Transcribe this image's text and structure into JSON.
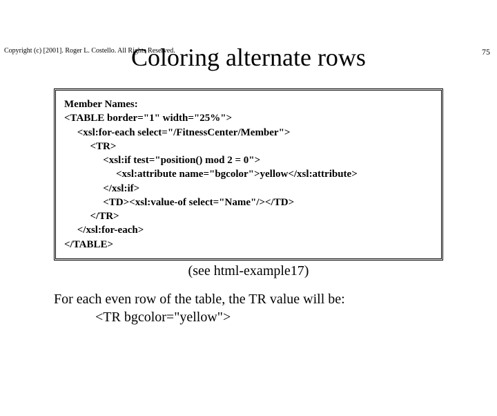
{
  "header": {
    "copyright": "Copyright (c) [2001]. Roger L. Costello. All Rights Reserved.",
    "page_number": "75"
  },
  "title": "Coloring alternate rows",
  "code": {
    "l1": "Member Names:",
    "l2": "<TABLE border=\"1\" width=\"25%\">",
    "l3": "     <xsl:for-each select=\"/FitnessCenter/Member\">",
    "l4": "          <TR>",
    "l5": "               <xsl:if test=\"position() mod 2 = 0\">",
    "l6": "                    <xsl:attribute name=\"bgcolor\">yellow</xsl:attribute>",
    "l7": "               </xsl:if>",
    "l8": "               <TD><xsl:value-of select=\"Name\"/></TD>",
    "l9": "          </TR>",
    "l10": "     </xsl:for-each>",
    "l11": "</TABLE>"
  },
  "note": "(see html-example17)",
  "explain": {
    "line1": "For each even row of the table, the TR value will be:",
    "line2": "<TR bgcolor=\"yellow\">"
  }
}
